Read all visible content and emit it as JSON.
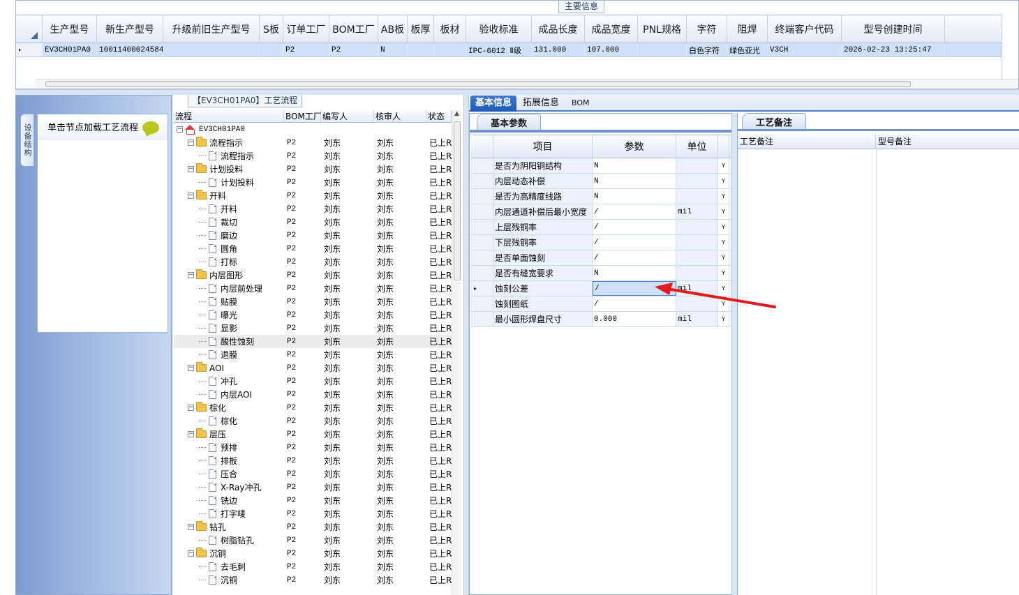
{
  "top": {
    "title": "主要信息",
    "columns": [
      "生产型号",
      "新生产型号",
      "升级前旧生产型号",
      "S板",
      "订单工厂",
      "BOM工厂",
      "AB板",
      "板厚",
      "板材",
      "验收标准",
      "成品长度",
      "成品宽度",
      "PNL规格",
      "字符",
      "阻焊",
      "终端客户代码",
      "型号创建时间"
    ],
    "row": [
      "EV3CH01PA0",
      "10011400024584",
      "",
      "",
      "P2",
      "P2",
      "N",
      "",
      "",
      "IPC-6012 Ⅱ级",
      "131.000",
      "107.000",
      "",
      "白色字符",
      "绿色亚光",
      "V3CH",
      "2026-02-23 13:25:47"
    ]
  },
  "left": {
    "vtab_label": "设备结构",
    "hint": "单击节点加载工艺流程"
  },
  "process": {
    "title": "【EV3CH01PA0】工艺流程",
    "columns": [
      "流程",
      "BOM工厂",
      "编写人",
      "核审人",
      "状态"
    ],
    "rows": [
      {
        "level": 0,
        "kind": "root",
        "name": "EV3CH01PA0",
        "bom": "",
        "writer": "",
        "checker": "",
        "status": ""
      },
      {
        "level": 1,
        "kind": "folder",
        "name": "流程指示",
        "bom": "P2",
        "writer": "刘东",
        "checker": "刘东",
        "status": "已上R"
      },
      {
        "level": 2,
        "kind": "doc",
        "name": "流程指示",
        "bom": "P2",
        "writer": "刘东",
        "checker": "刘东",
        "status": "已上R"
      },
      {
        "level": 1,
        "kind": "folder",
        "name": "计划投料",
        "bom": "P2",
        "writer": "刘东",
        "checker": "刘东",
        "status": "已上R"
      },
      {
        "level": 2,
        "kind": "doc",
        "name": "计划投料",
        "bom": "P2",
        "writer": "刘东",
        "checker": "刘东",
        "status": "已上R"
      },
      {
        "level": 1,
        "kind": "folder",
        "name": "开料",
        "bom": "P2",
        "writer": "刘东",
        "checker": "刘东",
        "status": "已上R"
      },
      {
        "level": 2,
        "kind": "doc",
        "name": "开料",
        "bom": "P2",
        "writer": "刘东",
        "checker": "刘东",
        "status": "已上R"
      },
      {
        "level": 2,
        "kind": "doc",
        "name": "裁切",
        "bom": "P2",
        "writer": "刘东",
        "checker": "刘东",
        "status": "已上R"
      },
      {
        "level": 2,
        "kind": "doc",
        "name": "磨边",
        "bom": "P2",
        "writer": "刘东",
        "checker": "刘东",
        "status": "已上R"
      },
      {
        "level": 2,
        "kind": "doc",
        "name": "圆角",
        "bom": "P2",
        "writer": "刘东",
        "checker": "刘东",
        "status": "已上R"
      },
      {
        "level": 2,
        "kind": "doc",
        "name": "打标",
        "bom": "P2",
        "writer": "刘东",
        "checker": "刘东",
        "status": "已上R"
      },
      {
        "level": 1,
        "kind": "folder",
        "name": "内层图形",
        "bom": "P2",
        "writer": "刘东",
        "checker": "刘东",
        "status": "已上R"
      },
      {
        "level": 2,
        "kind": "doc",
        "name": "内层前处理",
        "bom": "P2",
        "writer": "刘东",
        "checker": "刘东",
        "status": "已上R"
      },
      {
        "level": 2,
        "kind": "doc",
        "name": "贴膜",
        "bom": "P2",
        "writer": "刘东",
        "checker": "刘东",
        "status": "已上R"
      },
      {
        "level": 2,
        "kind": "doc",
        "name": "曝光",
        "bom": "P2",
        "writer": "刘东",
        "checker": "刘东",
        "status": "已上R"
      },
      {
        "level": 2,
        "kind": "doc",
        "name": "显影",
        "bom": "P2",
        "writer": "刘东",
        "checker": "刘东",
        "status": "已上R"
      },
      {
        "level": 2,
        "kind": "doc",
        "name": "酸性蚀刻",
        "bom": "P2",
        "writer": "刘东",
        "checker": "刘东",
        "status": "已上R",
        "selected": true
      },
      {
        "level": 2,
        "kind": "doc",
        "name": "退膜",
        "bom": "P2",
        "writer": "刘东",
        "checker": "刘东",
        "status": "已上R"
      },
      {
        "level": 1,
        "kind": "folder",
        "name": "AOI",
        "bom": "P2",
        "writer": "刘东",
        "checker": "刘东",
        "status": "已上R"
      },
      {
        "level": 2,
        "kind": "doc",
        "name": "冲孔",
        "bom": "P2",
        "writer": "刘东",
        "checker": "刘东",
        "status": "已上R"
      },
      {
        "level": 2,
        "kind": "doc",
        "name": "内层AOI",
        "bom": "P2",
        "writer": "刘东",
        "checker": "刘东",
        "status": "已上R"
      },
      {
        "level": 1,
        "kind": "folder",
        "name": "棕化",
        "bom": "P2",
        "writer": "刘东",
        "checker": "刘东",
        "status": "已上R"
      },
      {
        "level": 2,
        "kind": "doc",
        "name": "棕化",
        "bom": "P2",
        "writer": "刘东",
        "checker": "刘东",
        "status": "已上R"
      },
      {
        "level": 1,
        "kind": "folder",
        "name": "层压",
        "bom": "P2",
        "writer": "刘东",
        "checker": "刘东",
        "status": "已上R"
      },
      {
        "level": 2,
        "kind": "doc",
        "name": "预排",
        "bom": "P2",
        "writer": "刘东",
        "checker": "刘东",
        "status": "已上R"
      },
      {
        "level": 2,
        "kind": "doc",
        "name": "排板",
        "bom": "P2",
        "writer": "刘东",
        "checker": "刘东",
        "status": "已上R"
      },
      {
        "level": 2,
        "kind": "doc",
        "name": "压合",
        "bom": "P2",
        "writer": "刘东",
        "checker": "刘东",
        "status": "已上R"
      },
      {
        "level": 2,
        "kind": "doc",
        "name": "X-Ray冲孔",
        "bom": "P2",
        "writer": "刘东",
        "checker": "刘东",
        "status": "已上R"
      },
      {
        "level": 2,
        "kind": "doc",
        "name": "铣边",
        "bom": "P2",
        "writer": "刘东",
        "checker": "刘东",
        "status": "已上R"
      },
      {
        "level": 2,
        "kind": "doc",
        "name": "打字唛",
        "bom": "P2",
        "writer": "刘东",
        "checker": "刘东",
        "status": "已上R"
      },
      {
        "level": 1,
        "kind": "folder",
        "name": "钻孔",
        "bom": "P2",
        "writer": "刘东",
        "checker": "刘东",
        "status": "已上R"
      },
      {
        "level": 2,
        "kind": "doc",
        "name": "树脂钻孔",
        "bom": "P2",
        "writer": "刘东",
        "checker": "刘东",
        "status": "已上R"
      },
      {
        "level": 1,
        "kind": "folder",
        "name": "沉铜",
        "bom": "P2",
        "writer": "刘东",
        "checker": "刘东",
        "status": "已上R"
      },
      {
        "level": 2,
        "kind": "doc",
        "name": "去毛刺",
        "bom": "P2",
        "writer": "刘东",
        "checker": "刘东",
        "status": "已上R"
      },
      {
        "level": 2,
        "kind": "doc",
        "name": "沉铜",
        "bom": "P2",
        "writer": "刘东",
        "checker": "刘东",
        "status": "已上R"
      }
    ]
  },
  "tabs": [
    "基本信息",
    "拓展信息",
    "BOM"
  ],
  "basic": {
    "title": "基本参数",
    "columns": [
      "项目",
      "参数",
      "单位"
    ],
    "rows": [
      {
        "item": "是否为阴阳铜结构",
        "param": "N",
        "unit": "",
        "flag": "Y"
      },
      {
        "item": "内层动态补偿",
        "param": "N",
        "unit": "",
        "flag": "Y"
      },
      {
        "item": "是否为高精度线路",
        "param": "N",
        "unit": "",
        "flag": "Y"
      },
      {
        "item": "内层通道补偿后最小宽度",
        "param": "/",
        "unit": "mil",
        "flag": "Y"
      },
      {
        "item": "上层残铜率",
        "param": "/",
        "unit": "",
        "flag": "Y"
      },
      {
        "item": "下层残铜率",
        "param": "/",
        "unit": "",
        "flag": "Y"
      },
      {
        "item": "是否单面蚀刻",
        "param": "/",
        "unit": "",
        "flag": "Y"
      },
      {
        "item": "是否有缝宽要求",
        "param": "N",
        "unit": "",
        "flag": "Y"
      },
      {
        "item": "蚀刻公差",
        "param": "/",
        "unit": "mil",
        "flag": "Y",
        "selected": true
      },
      {
        "item": "蚀刻图纸",
        "param": "/",
        "unit": "",
        "flag": "Y"
      },
      {
        "item": "最小圆形焊盘尺寸",
        "param": "0.000",
        "unit": "mil",
        "flag": "Y"
      }
    ]
  },
  "remarks": {
    "title": "工艺备注",
    "columns": [
      "工艺备注",
      "型号备注"
    ]
  },
  "colors": {
    "accent": "#1d5bb5",
    "selection": "#cfe1f8",
    "arrow": "#e21c1c"
  }
}
